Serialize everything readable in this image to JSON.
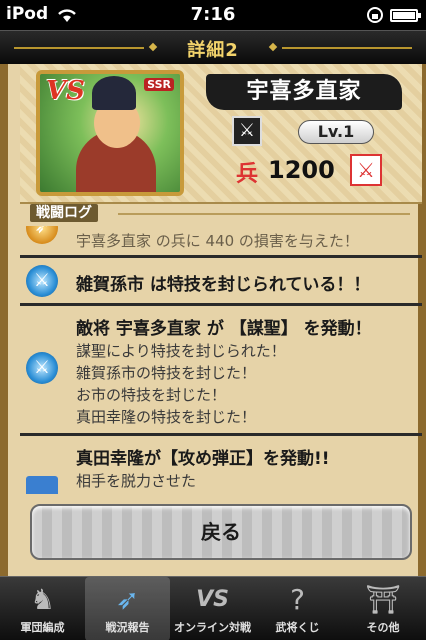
{
  "status": {
    "carrier": "iPod",
    "time": "7:16"
  },
  "header": {
    "title": "詳細2"
  },
  "card": {
    "vs_badge": "VS",
    "rarity": "SSR",
    "name": "宇喜多直家",
    "class_icon": "crossed-swords-icon",
    "level": "Lv.1",
    "troop_label": "兵",
    "troop_value": "1200",
    "weapon_icon": "sword-icon"
  },
  "section": {
    "label": "戦闘ログ"
  },
  "log": [
    {
      "head": "",
      "lines": [
        "宇喜多直家 の兵に 440 の損害を与えた！"
      ]
    },
    {
      "head": "雑賀孫市 は特技を封じられている！！",
      "lines": []
    },
    {
      "head": "敵将 宇喜多直家 が 【謀聖】 を発動！",
      "lines": [
        "謀聖により特技を封じられた！",
        "雑賀孫市の特技を封じた！",
        "お市の特技を封じた！",
        "真田幸隆の特技を封じた！"
      ]
    },
    {
      "head": "真田幸隆が【攻め弾正】を発動!!",
      "lines": [
        "相手を脱力させた"
      ]
    }
  ],
  "back_button": "戻る",
  "tabs": [
    {
      "label": "軍団編成",
      "icon": "samurai-helmet-icon",
      "active": false
    },
    {
      "label": "戦況報告",
      "icon": "spear-icon",
      "active": true
    },
    {
      "label": "オンライン対戦",
      "icon": "vs-icon",
      "active": false
    },
    {
      "label": "武将くじ",
      "icon": "question-icon",
      "active": false
    },
    {
      "label": "その他",
      "icon": "shrine-icon",
      "active": false
    }
  ]
}
